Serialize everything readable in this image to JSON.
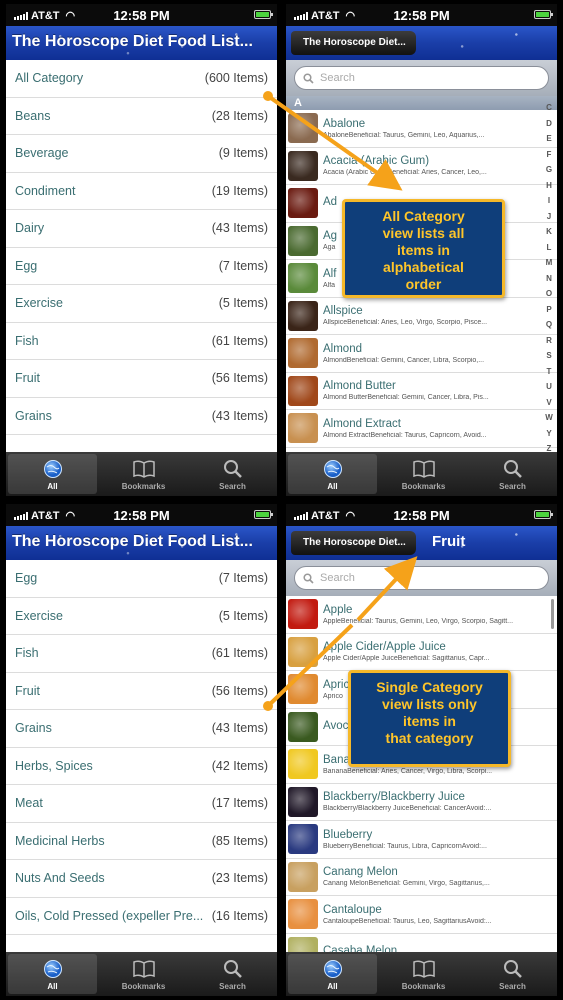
{
  "status": {
    "carrier": "AT&T",
    "time": "12:58 PM"
  },
  "colors": {
    "accent_orange": "#f5b829",
    "callout_bg": "#0f3e7a",
    "link_teal": "#3a6e71",
    "nav_blue": "#1a3ea8"
  },
  "app_title": "The Horoscope Diet Food List...",
  "back_label": "The Horoscope Diet...",
  "fruit_title": "Fruit",
  "search_placeholder": "Search",
  "section_letter": "A",
  "tabs": [
    {
      "label": "All",
      "icon": "globe-icon"
    },
    {
      "label": "Bookmarks",
      "icon": "book-icon"
    },
    {
      "label": "Search",
      "icon": "search-icon"
    }
  ],
  "categories_top": [
    {
      "name": "All Category",
      "count": "(600 Items)"
    },
    {
      "name": "Beans",
      "count": "(28 Items)"
    },
    {
      "name": "Beverage",
      "count": "(9 Items)"
    },
    {
      "name": "Condiment",
      "count": "(19 Items)"
    },
    {
      "name": "Dairy",
      "count": "(43 Items)"
    },
    {
      "name": "Egg",
      "count": "(7 Items)"
    },
    {
      "name": "Exercise",
      "count": "(5 Items)"
    },
    {
      "name": "Fish",
      "count": "(61 Items)"
    },
    {
      "name": "Fruit",
      "count": "(56 Items)"
    },
    {
      "name": "Grains",
      "count": "(43 Items)"
    }
  ],
  "categories_bottom": [
    {
      "name": "Egg",
      "count": "(7 Items)"
    },
    {
      "name": "Exercise",
      "count": "(5 Items)"
    },
    {
      "name": "Fish",
      "count": "(61 Items)"
    },
    {
      "name": "Fruit",
      "count": "(56 Items)"
    },
    {
      "name": "Grains",
      "count": "(43 Items)"
    },
    {
      "name": "Herbs, Spices",
      "count": "(42 Items)"
    },
    {
      "name": "Meat",
      "count": "(17 Items)"
    },
    {
      "name": "Medicinal Herbs",
      "count": "(85 Items)"
    },
    {
      "name": "Nuts And Seeds",
      "count": "(23 Items)"
    },
    {
      "name": "Oils, Cold Pressed (expeller Pre...",
      "count": "(16 Items)"
    }
  ],
  "all_foods": [
    {
      "name": "Abalone",
      "desc": "AbaloneBeneficial: Taurus, Gemini, Leo, Aquarius,...",
      "color": "#8a6a50"
    },
    {
      "name": "Acacia (Arabic Gum)",
      "desc": "Acacia (Arabic Gum)Beneficial: Aries, Cancer, Leo,...",
      "color": "#3a2a20"
    },
    {
      "name": "Ad",
      "desc": "",
      "color": "#6a1a10"
    },
    {
      "name": "Ag",
      "desc": "Aga",
      "color": "#4a6a30"
    },
    {
      "name": "Alf",
      "desc": "Alfa",
      "color": "#5a8a3a"
    },
    {
      "name": "Allspice",
      "desc": "AllspiceBeneficial: Aries, Leo, Virgo, Scorpio, Pisce...",
      "color": "#3a2418"
    },
    {
      "name": "Almond",
      "desc": "AlmondBeneficial: Gemini, Cancer, Libra, Scorpio,...",
      "color": "#b06a30"
    },
    {
      "name": "Almond Butter",
      "desc": "Almond ButterBeneficial: Gemini, Cancer, Libra, Pis...",
      "color": "#a0481a"
    },
    {
      "name": "Almond Extract",
      "desc": "Almond ExtractBeneficial: Taurus, Capricorn, Avoid...",
      "color": "#c89050"
    }
  ],
  "index_letters": [
    "C",
    "D",
    "E",
    "F",
    "G",
    "H",
    "I",
    "J",
    "K",
    "L",
    "M",
    "N",
    "O",
    "P",
    "Q",
    "R",
    "S",
    "T",
    "U",
    "V",
    "W",
    "Y",
    "Z"
  ],
  "fruit_foods": [
    {
      "name": "Apple",
      "desc": "AppleBeneficial: Taurus, Gemini, Leo, Virgo, Scorpio, Sagitt...",
      "color": "#c21a10"
    },
    {
      "name": "Apple Cider/Apple Juice",
      "desc": "Apple Cider/Apple JuiceBeneficial: Sagittarius, Capr...",
      "color": "#d8a040"
    },
    {
      "name": "Apric",
      "desc": "Aprico",
      "color": "#e08a30"
    },
    {
      "name": "Avoc",
      "desc": "",
      "color": "#3a5a20"
    },
    {
      "name": "Bana",
      "desc": "BananaBeneficial: Aries, Cancer, Virgo, Libra, Scorpi...",
      "color": "#f0c820"
    },
    {
      "name": "Blackberry/Blackberry Juice",
      "desc": "Blackberry/Blackberry JuiceBeneficial: CancerAvoid:...",
      "color": "#201828"
    },
    {
      "name": "Blueberry",
      "desc": "BlueberryBeneficial: Taurus, Libra, CapricornAvoid:...",
      "color": "#2a3a80"
    },
    {
      "name": "Canang Melon",
      "desc": "Canang MelonBeneficial: Gemini, Virgo, Sagittarius,...",
      "color": "#c8a060"
    },
    {
      "name": "Cantaloupe",
      "desc": "CantaloupeBeneficial: Taurus, Leo, SagittariusAvoid:...",
      "color": "#e89040"
    },
    {
      "name": "Casaba Melon",
      "desc": "",
      "color": "#b0b060"
    }
  ],
  "callout1": [
    "All Category",
    "view lists all",
    "items in",
    "alphabetical",
    "order"
  ],
  "callout2": [
    "Single Category",
    "view lists only",
    "items in",
    "that category"
  ]
}
